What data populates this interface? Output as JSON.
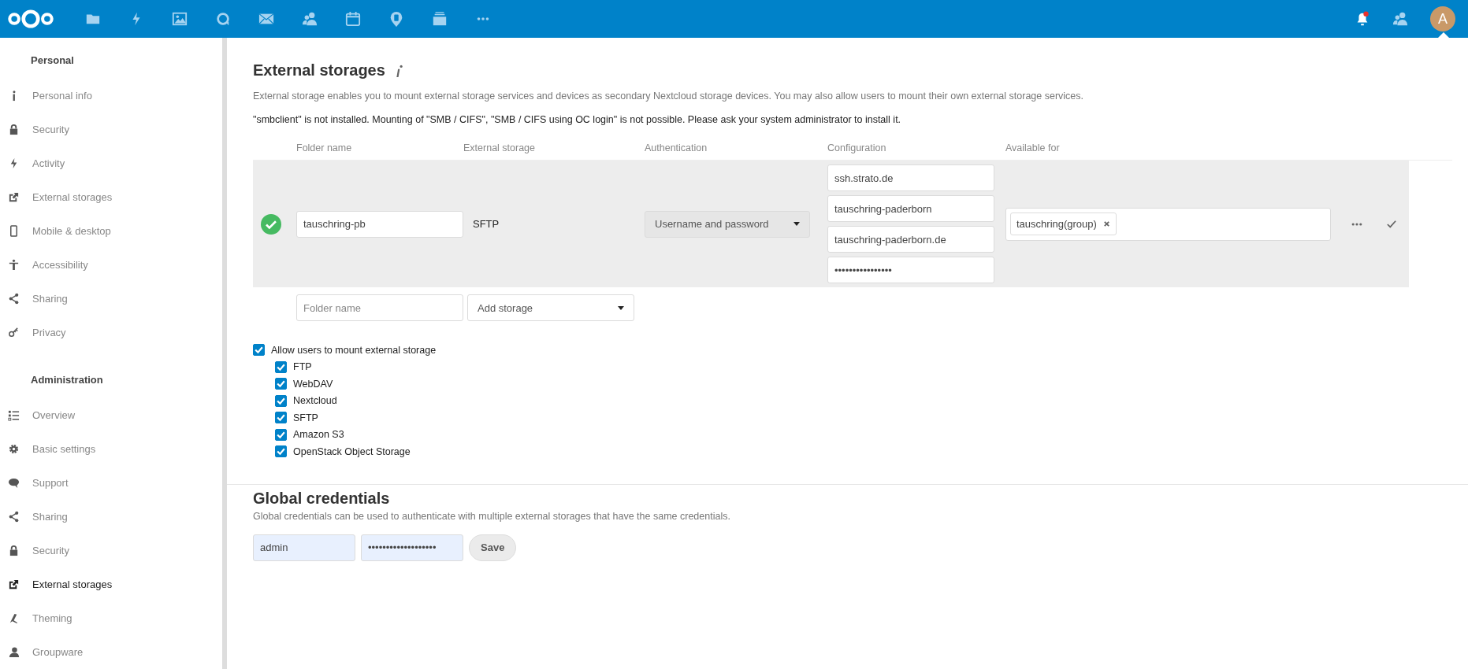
{
  "header": {
    "notification_unread": true,
    "avatar_initial": "A"
  },
  "sidebar": {
    "sections": [
      {
        "heading": "Personal",
        "items": [
          {
            "label": "Personal info",
            "selected": false
          },
          {
            "label": "Security",
            "selected": false
          },
          {
            "label": "Activity",
            "selected": false
          },
          {
            "label": "External storages",
            "selected": false
          },
          {
            "label": "Mobile & desktop",
            "selected": false
          },
          {
            "label": "Accessibility",
            "selected": false
          },
          {
            "label": "Sharing",
            "selected": false
          },
          {
            "label": "Privacy",
            "selected": false
          }
        ]
      },
      {
        "heading": "Administration",
        "items": [
          {
            "label": "Overview",
            "selected": false
          },
          {
            "label": "Basic settings",
            "selected": false
          },
          {
            "label": "Support",
            "selected": false
          },
          {
            "label": "Sharing",
            "selected": false
          },
          {
            "label": "Security",
            "selected": false
          },
          {
            "label": "External storages",
            "selected": true
          },
          {
            "label": "Theming",
            "selected": false
          },
          {
            "label": "Groupware",
            "selected": false
          }
        ]
      }
    ]
  },
  "external_storages": {
    "title": "External storages",
    "description": "External storage enables you to mount external storage services and devices as secondary Nextcloud storage devices. You may also allow users to mount their own external storage services.",
    "warning": "\"smbclient\" is not installed. Mounting of \"SMB / CIFS\", \"SMB / CIFS using OC login\" is not possible. Please ask your system administrator to install it.",
    "columns": [
      "Folder name",
      "External storage",
      "Authentication",
      "Configuration",
      "Available for"
    ],
    "rows": [
      {
        "ok": true,
        "folder_name": "tauschring-pb",
        "storage": "SFTP",
        "authentication": "Username and password",
        "configuration": [
          "ssh.strato.de",
          "tauschring-paderborn",
          "tauschring-paderborn.de",
          "••••••••••••••••"
        ],
        "available_for": [
          "tauschring(group)"
        ]
      }
    ],
    "new_row": {
      "folder_placeholder": "Folder name",
      "storage_placeholder": "Add storage"
    },
    "allow_users": {
      "label": "Allow users to mount external storage",
      "checked": true
    },
    "backends": [
      {
        "label": "FTP",
        "checked": true
      },
      {
        "label": "WebDAV",
        "checked": true
      },
      {
        "label": "Nextcloud",
        "checked": true
      },
      {
        "label": "SFTP",
        "checked": true
      },
      {
        "label": "Amazon S3",
        "checked": true
      },
      {
        "label": "OpenStack Object Storage",
        "checked": true
      }
    ]
  },
  "global_credentials": {
    "title": "Global credentials",
    "description": "Global credentials can be used to authenticate with multiple external storages that have the same credentials.",
    "username": "admin",
    "password": "•••••••••••••••••••",
    "save": "Save"
  }
}
